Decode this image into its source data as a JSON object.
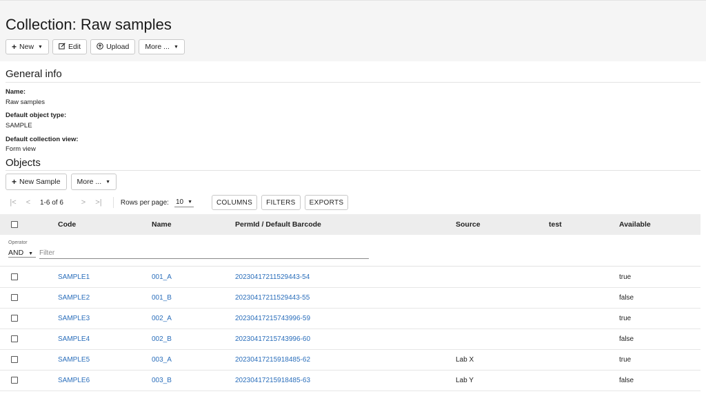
{
  "page": {
    "title": "Collection: Raw samples"
  },
  "toolbar": {
    "new_label": "New",
    "edit_label": "Edit",
    "upload_label": "Upload",
    "more_label": "More ..."
  },
  "general_info": {
    "title": "General info",
    "fields": [
      {
        "label": "Name:",
        "value": "Raw samples"
      },
      {
        "label": "Default object type:",
        "value": "SAMPLE"
      },
      {
        "label": "Default collection view:",
        "value": "Form view"
      }
    ]
  },
  "objects": {
    "title": "Objects",
    "new_sample_label": "New Sample",
    "more_label": "More ...",
    "pager": {
      "range": "1-6 of 6",
      "rows_per_page_label": "Rows per page:",
      "rows_per_page_value": "10"
    },
    "buttons": {
      "columns": "COLUMNS",
      "filters": "FILTERS",
      "exports": "EXPORTS"
    },
    "columns": [
      "Code",
      "Name",
      "PermId / Default Barcode",
      "Source",
      "test",
      "Available"
    ],
    "filter": {
      "operator_label": "Operator",
      "operator_value": "AND",
      "placeholder": "Filter"
    },
    "rows": [
      {
        "code": "SAMPLE1",
        "name": "001_A",
        "permid": "20230417211529443-54",
        "source": "",
        "test": "",
        "available": "true"
      },
      {
        "code": "SAMPLE2",
        "name": "001_B",
        "permid": "20230417211529443-55",
        "source": "",
        "test": "",
        "available": "false"
      },
      {
        "code": "SAMPLE3",
        "name": "002_A",
        "permid": "20230417215743996-59",
        "source": "",
        "test": "",
        "available": "true"
      },
      {
        "code": "SAMPLE4",
        "name": "002_B",
        "permid": "20230417215743996-60",
        "source": "",
        "test": "",
        "available": "false"
      },
      {
        "code": "SAMPLE5",
        "name": "003_A",
        "permid": "20230417215918485-62",
        "source": "Lab X",
        "test": "",
        "available": "true"
      },
      {
        "code": "SAMPLE6",
        "name": "003_B",
        "permid": "20230417215918485-63",
        "source": "Lab Y",
        "test": "",
        "available": "false"
      }
    ]
  },
  "colors": {
    "link": "#2a6ebb",
    "header_bg": "#ededed",
    "topbar_bg": "#f5f5f5"
  }
}
